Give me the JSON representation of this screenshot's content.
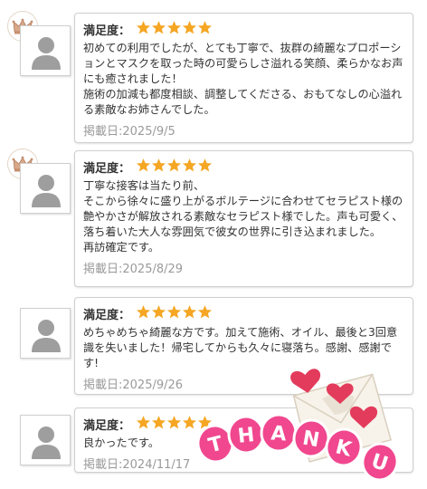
{
  "reviews": [
    {
      "satisfaction_label": "満足度：",
      "rating": 5,
      "crowned": true,
      "text": "初めての利用でしたが、とても丁寧で、抜群の綺麗なプロポーションとマスクを取った時の可愛らしさ溢れる笑顔、柔らかなお声にも癒されました！\n施術の加減も都度相談、調整してくださる、おもてなしの心溢れる素敵なお姉さんでした。",
      "date": "掲載日:2025/9/5"
    },
    {
      "satisfaction_label": "満足度：",
      "rating": 5,
      "crowned": true,
      "text": "丁寧な接客は当たり前、\nそこから徐々に盛り上がるボルテージに合わせてセラピスト様の艶やかさが解放される素敵なセラピスト様でした。声も可愛く、落ち着いた大人な雰囲気で彼女の世界に引き込まれました。\n再訪確定です。",
      "date": "掲載日:2025/8/29"
    },
    {
      "satisfaction_label": "満足度：",
      "rating": 5,
      "crowned": false,
      "text": "めちゃめちゃ綺麗な方です。加えて施術、オイル、最後と3回意識を失いました！帰宅してからも久々に寝落ち。感謝、感謝です!",
      "date": "掲載日:2025/9/26"
    },
    {
      "satisfaction_label": "満足度：",
      "rating": 5,
      "crowned": false,
      "text": "良かったです。",
      "date": "掲載日:2024/11/17"
    }
  ],
  "sticker": {
    "letters": [
      "T",
      "H",
      "A",
      "N",
      "K",
      "U"
    ],
    "balloon_color": "#f0478f",
    "heart_color": "#e33b5c"
  },
  "colors": {
    "star": "#f5a623",
    "card_border": "#cfcfcf",
    "date": "#9a9a9a"
  },
  "icons": {
    "crown": "crown-icon",
    "avatar": "user-silhouette-icon",
    "star": "star-icon"
  }
}
